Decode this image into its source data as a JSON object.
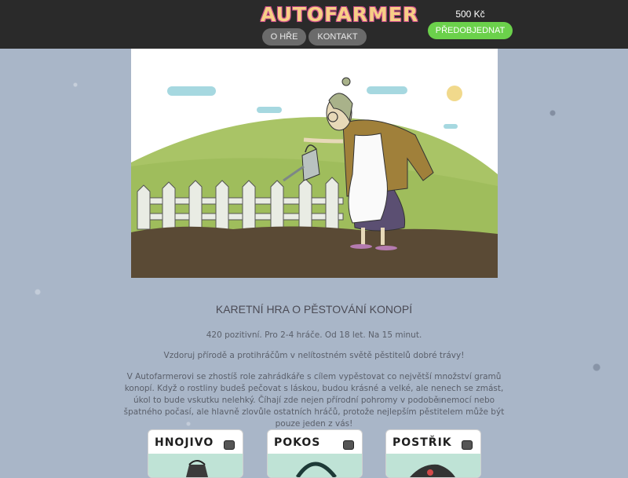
{
  "header": {
    "logo_text": "AUTOFARMER",
    "nav": [
      {
        "label": "O HŘE"
      },
      {
        "label": "KONTAKT"
      }
    ],
    "price": "500 Kč",
    "preorder_label": "PŘEDOBJEDNAT"
  },
  "main": {
    "heading": "KARETNÍ HRA O PĚSTOVÁNÍ KONOPÍ",
    "info_line": "420 pozitivní. Pro 2-4 hráče. Od 18 let. Na 15 minut.",
    "tagline": "Vzdoruj přírodě a protihráčům v nelítostném světě pěstitelů dobré trávy!",
    "description": "V Autofarmerovi se zhostíš role zahrádkáře s cílem vypěstovat co největší množství gramů konopí. Když o rostliny budeš pečovat s láskou, budou krásné a velké, ale nenech se zmást, úkol to bude vskutku nelehký. Číhají zde nejen přírodní pohromy v podobě nemocí nebo špatného počasí, ale hlavně zlovůle ostatních hráčů, protože nejlepším pěstitelem může být pouze jeden z vás!"
  },
  "cards": [
    {
      "title": "HNOJIVO"
    },
    {
      "title": "POKOS"
    },
    {
      "title": "POSTŘIK"
    }
  ],
  "colors": {
    "header_bg": "#2a2a2a",
    "nav_button": "#6b6b6b",
    "preorder_green": "#6bd14b",
    "page_bg": "#a9b6c8"
  }
}
